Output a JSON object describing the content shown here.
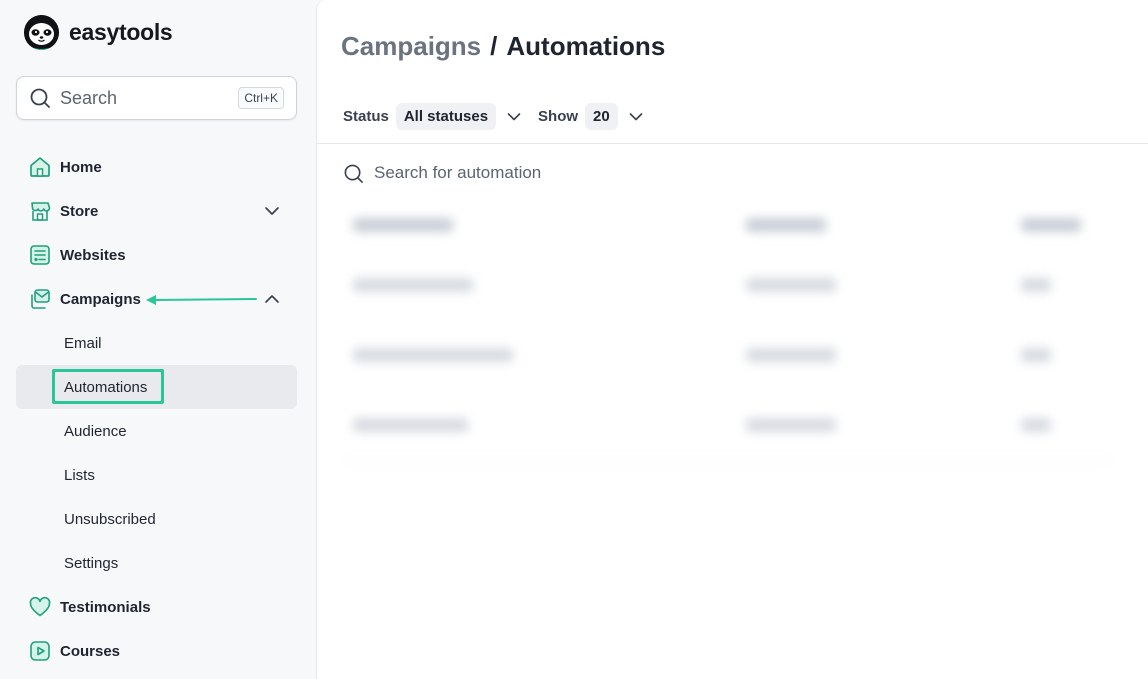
{
  "app": {
    "brand": "easytools",
    "colors": {
      "accent": "#2bc59a",
      "text": "#1f2430",
      "muted": "#6b7280"
    }
  },
  "sidebar": {
    "search": {
      "label": "Search",
      "shortcut": "Ctrl+K",
      "icon": "search-icon"
    },
    "items": [
      {
        "label": "Home",
        "icon": "home-icon"
      },
      {
        "label": "Store",
        "icon": "store-icon",
        "expandable": true,
        "expanded": false
      },
      {
        "label": "Websites",
        "icon": "websites-icon"
      },
      {
        "label": "Campaigns",
        "icon": "campaigns-icon",
        "expandable": true,
        "expanded": true
      },
      {
        "label": "Testimonials",
        "icon": "heart-icon"
      },
      {
        "label": "Courses",
        "icon": "play-icon"
      }
    ],
    "campaign_subitems": [
      {
        "label": "Email",
        "active": false
      },
      {
        "label": "Automations",
        "active": true
      },
      {
        "label": "Audience",
        "active": false
      },
      {
        "label": "Lists",
        "active": false
      },
      {
        "label": "Unsubscribed",
        "active": false
      },
      {
        "label": "Settings",
        "active": false
      }
    ]
  },
  "main": {
    "breadcrumb": {
      "parent": "Campaigns",
      "separator": "/",
      "current": "Automations"
    },
    "filters": {
      "status_label": "Status",
      "status_value": "All statuses",
      "show_label": "Show",
      "show_value": "20"
    },
    "table_search": {
      "placeholder": "Search for automation",
      "icon": "search-icon"
    }
  }
}
